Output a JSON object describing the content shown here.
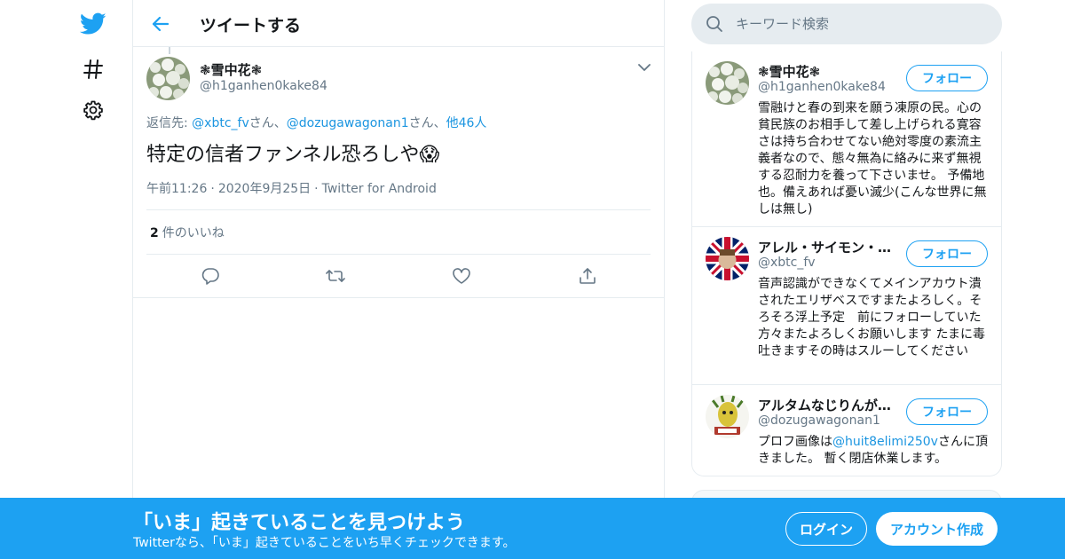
{
  "colors": {
    "brand": "#1da1f2",
    "link": "#1b95e0",
    "text_primary": "#14171a",
    "text_secondary": "#657786",
    "border": "#e6ecf0"
  },
  "nav": {
    "items": [
      {
        "icon": "twitter-bird-icon"
      },
      {
        "icon": "hashtag-icon"
      },
      {
        "icon": "gear-icon"
      }
    ]
  },
  "header": {
    "back_icon": "arrow-left-icon",
    "title": "ツイートする"
  },
  "tweet": {
    "author_name": "❃雪中花❃",
    "author_handle": "@h1ganhen0kake84",
    "reply_prefix": "返信先: ",
    "reply_user1": "@xbtc_fv",
    "reply_sep1": "さん、",
    "reply_user2": "@dozugawagonan1",
    "reply_sep2": "さん、",
    "reply_others": "他46人",
    "text": "特定の信者ファンネル恐ろしや😱",
    "time": "午前11:26",
    "date": "2020年9月25日",
    "source": "Twitter for Android",
    "likes_count": "2",
    "likes_label": "件のいいね",
    "actions": [
      "reply-icon",
      "retweet-icon",
      "like-icon",
      "share-icon"
    ]
  },
  "search": {
    "placeholder": "キーワード検索"
  },
  "people": [
    {
      "name": "❃雪中花❃",
      "handle": "@h1ganhen0kake84",
      "follow_label": "フォロー",
      "bio": "雪融けと春の到来を願う凍原の民。心の貧民族のお相手して差し上げられる寛容さは持ち合わせてない絶対零度の素流主義者なので、態々無為に絡みに来ず無視する忍耐力を養って下さいませ。 予備地也。備えあれば憂い滅少(こんな世界に無しは無し)"
    },
    {
      "name": "アレル・サイモン・…",
      "handle": "@xbtc_fv",
      "follow_label": "フォロー",
      "bio": "音声認識ができなくてメインアカウト潰されたエリザベスですまたよろしく。そろそろ浮上予定　前にフォローしていた方々またよろしくお願いします たまに毒吐きますその時はスルーしてください"
    },
    {
      "name": "アルタムなじりんが…",
      "handle": "@dozugawagonan1",
      "follow_label": "フォロー",
      "bio_prefix": "プロフ画像は",
      "bio_link": "@huit8elimi250v",
      "bio_suffix": "さんに頂きました。 暫く閉店休業します。"
    }
  ],
  "banner": {
    "title": "「いま」起きていることを見つけよう",
    "subtitle": "Twitterなら、「いま」起きていることをいち早くチェックできます。",
    "login_label": "ログイン",
    "signup_label": "アカウント作成"
  }
}
